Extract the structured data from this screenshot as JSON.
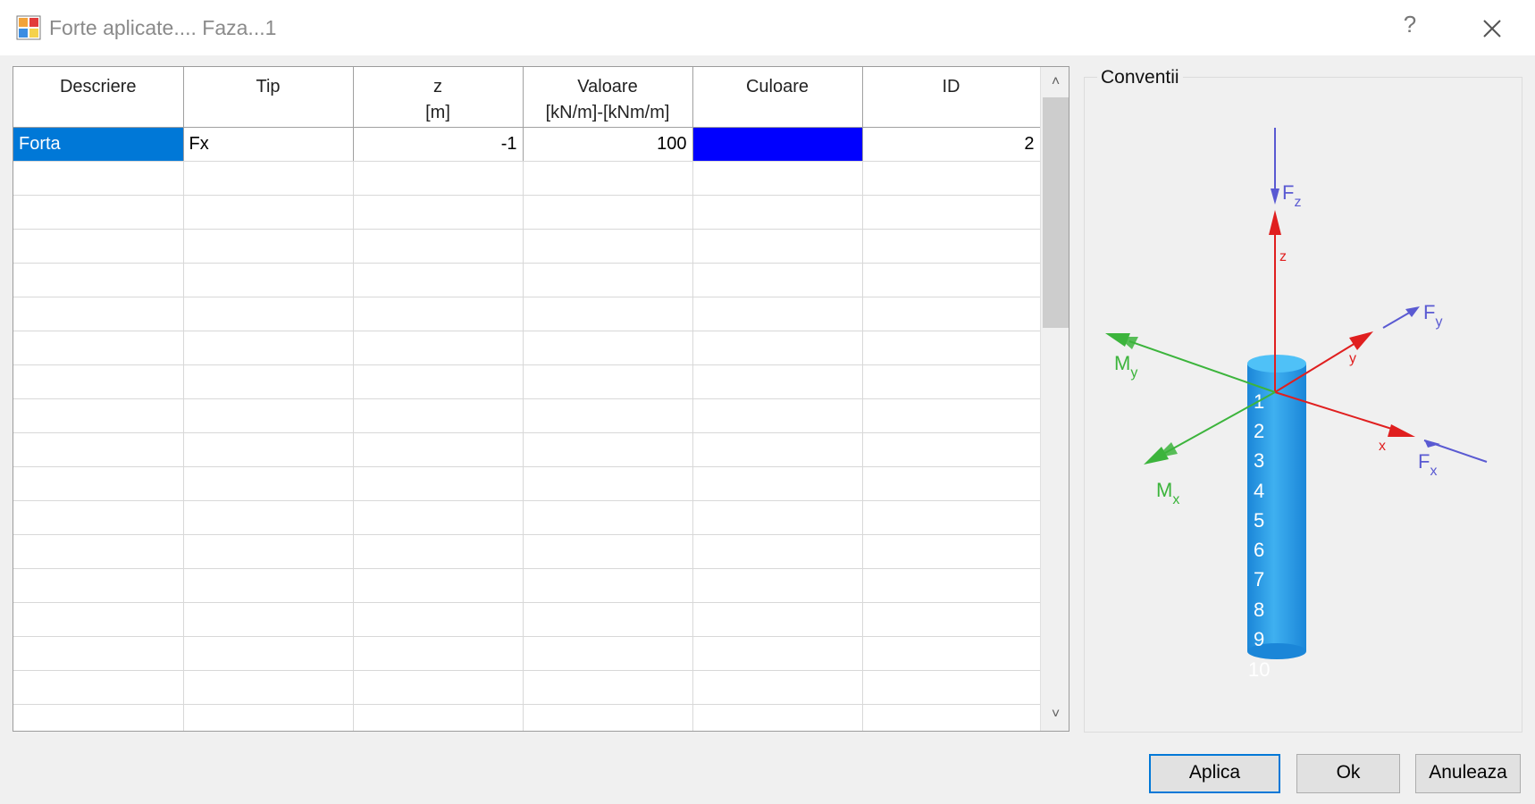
{
  "window": {
    "title": "Forte aplicate.... Faza...1",
    "help_glyph": "?",
    "app_icon": "form-app-icon"
  },
  "grid": {
    "columns": [
      {
        "line1": "Descriere",
        "line2": ""
      },
      {
        "line1": "Tip",
        "line2": ""
      },
      {
        "line1": "z",
        "line2": "[m]"
      },
      {
        "line1": "Valoare",
        "line2": "[kN/m]-[kNm/m]"
      },
      {
        "line1": "Culoare",
        "line2": ""
      },
      {
        "line1": "ID",
        "line2": ""
      }
    ],
    "rows": [
      {
        "descriere": "Forta",
        "tip": "Fx",
        "z": "-1",
        "valoare": "100",
        "culoare": "#0000ff",
        "id": "2"
      }
    ]
  },
  "conventions": {
    "group_label": "Conventii",
    "axes": {
      "z": "z",
      "y": "y",
      "x": "x"
    },
    "forces": {
      "fz": "F",
      "fz_sub": "z",
      "fy": "F",
      "fy_sub": "y",
      "fx": "F",
      "fx_sub": "x"
    },
    "moments": {
      "my": "M",
      "my_sub": "y",
      "mx": "M",
      "mx_sub": "x"
    },
    "column_numbers": [
      "1",
      "2",
      "3",
      "4",
      "5",
      "6",
      "7",
      "8",
      "9",
      "10"
    ],
    "colors": {
      "z_axis": "#e01f1f",
      "force": "#5a5ad2",
      "moment": "#3cb43c",
      "column": "#2da0e8"
    }
  },
  "buttons": {
    "apply": "Aplica",
    "ok": "Ok",
    "cancel": "Anuleaza"
  }
}
